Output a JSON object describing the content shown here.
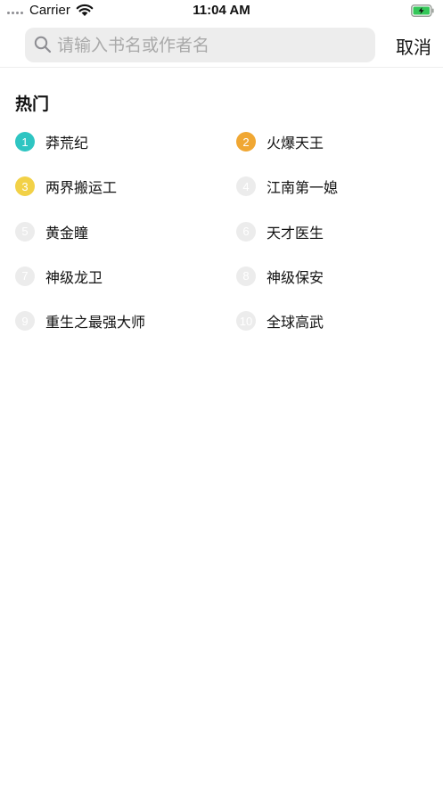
{
  "status_bar": {
    "carrier": "Carrier",
    "time": "11:04 AM",
    "battery_color": "#34c759"
  },
  "search": {
    "placeholder": "请输入书名或作者名",
    "value": "",
    "cancel_label": "取消"
  },
  "hot": {
    "title": "热门",
    "items": [
      {
        "rank": "1",
        "title": "莽荒纪",
        "badge_color": "#2ec5c2"
      },
      {
        "rank": "2",
        "title": "火爆天王",
        "badge_color": "#f0a733"
      },
      {
        "rank": "3",
        "title": "两界搬运工",
        "badge_color": "#f2d147"
      },
      {
        "rank": "4",
        "title": "江南第一媳",
        "badge_color": "#ececec"
      },
      {
        "rank": "5",
        "title": "黄金瞳",
        "badge_color": "#ececec"
      },
      {
        "rank": "6",
        "title": "天才医生",
        "badge_color": "#ececec"
      },
      {
        "rank": "7",
        "title": "神级龙卫",
        "badge_color": "#ececec"
      },
      {
        "rank": "8",
        "title": "神级保安",
        "badge_color": "#ececec"
      },
      {
        "rank": "9",
        "title": "重生之最强大师",
        "badge_color": "#ececec"
      },
      {
        "rank": "10",
        "title": "全球高武",
        "badge_color": "#ececec"
      }
    ]
  }
}
